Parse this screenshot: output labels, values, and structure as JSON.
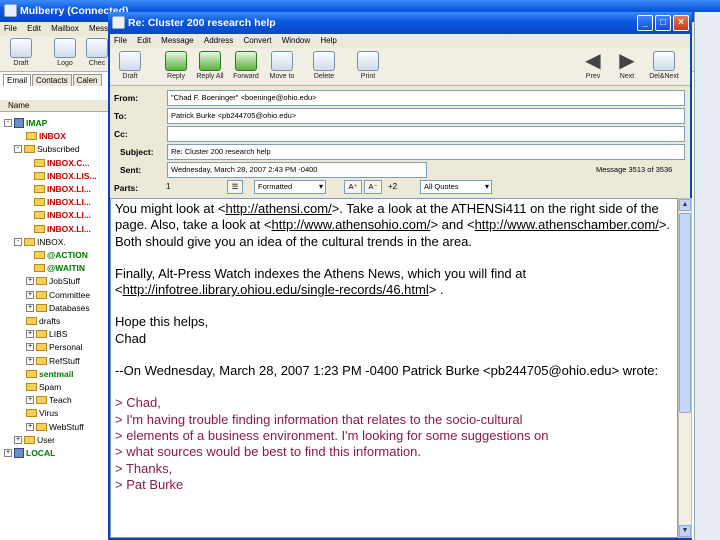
{
  "main": {
    "title": "Mulberry (Connected)",
    "menu": [
      "File",
      "Edit",
      "Mailbox",
      "Message"
    ],
    "toolbar": [
      "Draft",
      "Logo",
      "Chec"
    ],
    "tabs": [
      "Email",
      "Contacts",
      "Calen"
    ],
    "name_header": "Name",
    "tree": [
      {
        "label": "IMAP",
        "style": "grn",
        "pm": "-"
      },
      {
        "label": "INBOX",
        "style": "red"
      },
      {
        "label": "Subscribed",
        "style": "blk",
        "pm": "-"
      },
      {
        "label": "INBOX.C...",
        "style": "red"
      },
      {
        "label": "INBOX.LIS...",
        "style": "red"
      },
      {
        "label": "INBOX.LI...",
        "style": "red"
      },
      {
        "label": "INBOX.LI...",
        "style": "red"
      },
      {
        "label": "INBOX.LI...",
        "style": "red"
      },
      {
        "label": "INBOX.LI...",
        "style": "red"
      },
      {
        "label": "INBOX.",
        "style": "blk",
        "pm": "-"
      },
      {
        "label": "@ACTION",
        "style": "grn"
      },
      {
        "label": "@WAITIN",
        "style": "grn"
      },
      {
        "label": "JobStuff",
        "style": "blk",
        "pm": "+"
      },
      {
        "label": "Committee",
        "style": "blk",
        "pm": "+"
      },
      {
        "label": "Databases",
        "style": "blk",
        "pm": "+"
      },
      {
        "label": "drafts",
        "style": "blk"
      },
      {
        "label": "LIBS",
        "style": "blk",
        "pm": "+"
      },
      {
        "label": "Personal",
        "style": "blk",
        "pm": "+"
      },
      {
        "label": "RefStuff",
        "style": "blk",
        "pm": "+"
      },
      {
        "label": "sentmail",
        "style": "grn"
      },
      {
        "label": "Spam",
        "style": "blk"
      },
      {
        "label": "Teach",
        "style": "blk",
        "pm": "+"
      },
      {
        "label": "Virus",
        "style": "blk"
      },
      {
        "label": "WebStuff",
        "style": "blk",
        "pm": "+"
      },
      {
        "label": "User",
        "style": "blk",
        "pm": "+"
      },
      {
        "label": "LOCAL",
        "style": "grn",
        "pm": "+"
      }
    ]
  },
  "message_window": {
    "title": "Re: Cluster 200 research help",
    "menu": [
      "File",
      "Edit",
      "Message",
      "Address",
      "Convert",
      "Window",
      "Help"
    ],
    "toolbar": {
      "draft": "Draft",
      "reply": "Reply",
      "reply_all": "Reply All",
      "forward": "Forward",
      "move_to": "Move to",
      "delete": "Delete",
      "print": "Print",
      "prev": "Prev",
      "next": "Next",
      "delete_next": "Del&Next"
    },
    "labels": {
      "from": "From:",
      "to": "To:",
      "cc": "Cc:",
      "subject": "Subject:",
      "sent": "Sent:",
      "parts": "Parts:"
    },
    "fields": {
      "from": "\"Chad F. Boeninger\" <boeninge@ohio.edu>",
      "to": "Patrick Burke <pb244705@ohio.edu>",
      "cc": "",
      "subject": "Re: Cluster 200 research help",
      "sent": "Wednesday, March 28, 2007 2:43 PM -0400",
      "message_count": "Message 3513 of 3536",
      "parts_count": "1",
      "format": "Formatted",
      "font_size_delta": "+2",
      "quote_mode": "All Quotes"
    },
    "body": {
      "p1_a": "You might look at <",
      "p1_link1": "http://athensi.com/",
      "p1_b": ">.  Take a look at the ATHENSi411 on the right side of the page.  Also, take a look at <",
      "p1_link2": "http://www.athensohio.com/",
      "p1_c": "> and <",
      "p1_link3": "http://www.athenschamber.com/",
      "p1_d": ">.  Both should give you an idea of the cultural trends in the area.",
      "p2_a": "Finally, Alt-Press Watch indexes the Athens News, which you will find at <",
      "p2_link": "http://infotree.library.ohiou.edu/single-records/46.html",
      "p2_b": "> .",
      "p3_1": "Hope this helps,",
      "p3_2": "Chad",
      "p4": "--On Wednesday, March 28, 2007 1:23 PM -0400 Patrick Burke <pb244705@ohio.edu> wrote:",
      "quotes": [
        "> Chad,",
        "> I'm having trouble finding information that relates to the socio-cultural",
        "> elements of a business environment.  I'm looking for some suggestions on",
        "> what sources would be best to find this information.",
        "> Thanks,",
        "> Pat Burke"
      ]
    }
  }
}
